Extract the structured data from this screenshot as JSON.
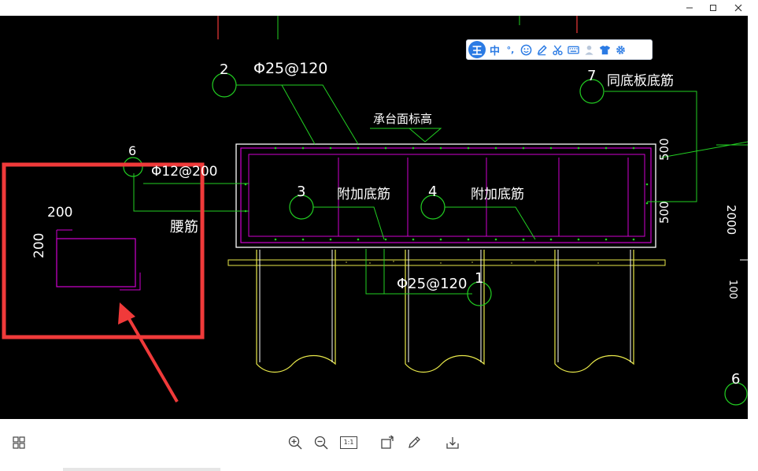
{
  "ime_bar": {
    "logo": "王",
    "mode": "中",
    "punct": "°,",
    "icons": [
      "emoji-icon",
      "pen-icon",
      "scissors-icon",
      "keyboard-icon",
      "user-icon",
      "shirt-icon",
      "gear-icon"
    ]
  },
  "drawing": {
    "section_labels": {
      "bar1_label": "Φ25@120",
      "bar2_label": "Φ25@120",
      "waist_label": "Φ12@200",
      "waist_text": "腰筋",
      "cap_elevation": "承台面标高",
      "extra_bottom_a": "附加底筋",
      "extra_bottom_b": "附加底筋",
      "same_bottom": "同底板底筋",
      "dim_500_top": "500",
      "dim_500_bottom": "500",
      "dim_2000": "2000",
      "dim_100": "100"
    },
    "callouts": [
      "1",
      "2",
      "3",
      "4",
      "6",
      "7",
      "6"
    ],
    "detail": {
      "width_label": "200",
      "height_label": "200"
    }
  },
  "colors": {
    "canvas": "#000000",
    "highlight_red": "#f03a3a",
    "rebar_magenta": "#d000d0",
    "leader_green": "#22d022",
    "pile_yellow": "#e8e84a",
    "outline_white": "#ffffff"
  },
  "toolbar": {
    "buttons": [
      "grid-view-icon",
      "zoom-in-icon",
      "zoom-out-icon",
      "actual-size-icon",
      "rotate-icon",
      "edit-icon",
      "download-icon"
    ],
    "actual_size_text": "1:1"
  }
}
